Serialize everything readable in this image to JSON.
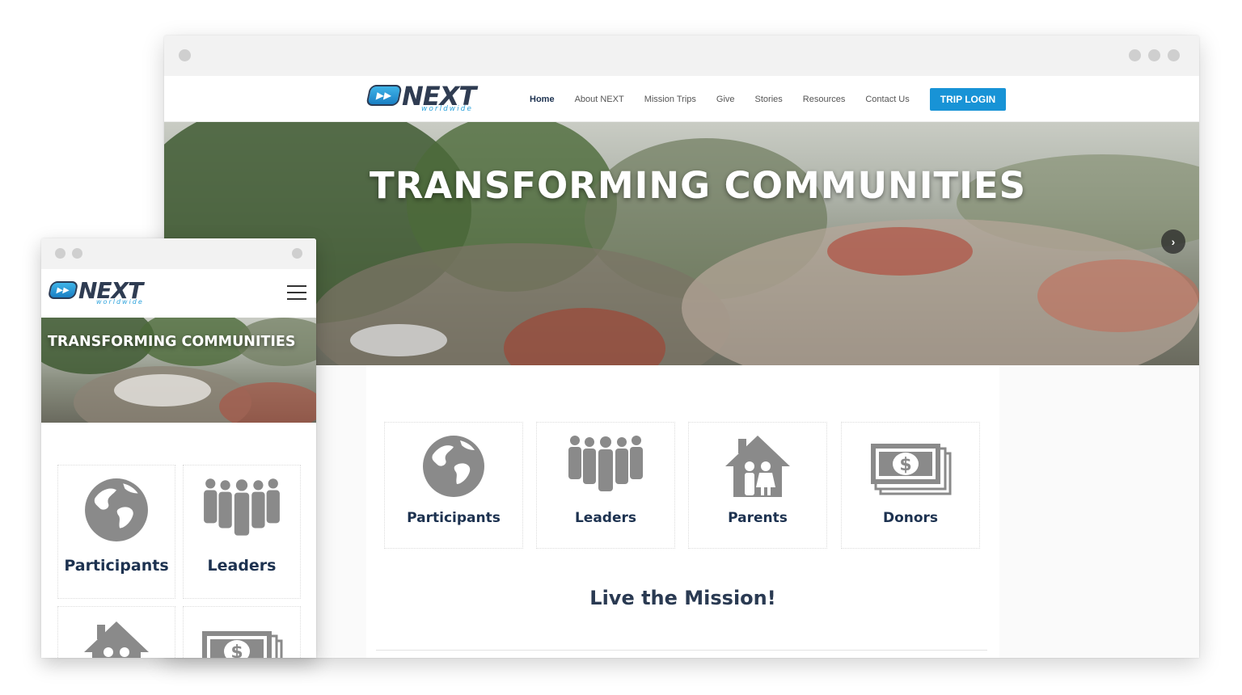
{
  "desktop": {
    "logo": {
      "brand": "NEXT",
      "sub": "worldwide"
    },
    "nav": [
      {
        "label": "Home",
        "active": true
      },
      {
        "label": "About NEXT"
      },
      {
        "label": "Mission Trips"
      },
      {
        "label": "Give"
      },
      {
        "label": "Stories"
      },
      {
        "label": "Resources"
      },
      {
        "label": "Contact Us"
      }
    ],
    "login_label": "TRIP LOGIN",
    "hero_title": "TRANSFORMING COMMUNITIES",
    "next_arrow": "›",
    "prev_arrow": "‹",
    "cards": [
      {
        "label": "Participants",
        "icon": "globe-icon"
      },
      {
        "label": "Leaders",
        "icon": "group-icon"
      },
      {
        "label": "Parents",
        "icon": "home-family-icon"
      },
      {
        "label": "Donors",
        "icon": "money-icon"
      }
    ],
    "mission_heading": "Live the Mission!"
  },
  "mobile": {
    "logo": {
      "brand": "NEXT",
      "sub": "worldwide"
    },
    "hero_title": "TRANSFORMING COMMUNITIES",
    "cards": [
      {
        "label": "Participants",
        "icon": "globe-icon"
      },
      {
        "label": "Leaders",
        "icon": "group-icon"
      },
      {
        "label": "",
        "icon": "home-family-icon"
      },
      {
        "label": "",
        "icon": "money-icon"
      }
    ]
  },
  "colors": {
    "accent": "#1893d6",
    "heading": "#1d3250",
    "icon_gray": "#8a8a8a"
  }
}
